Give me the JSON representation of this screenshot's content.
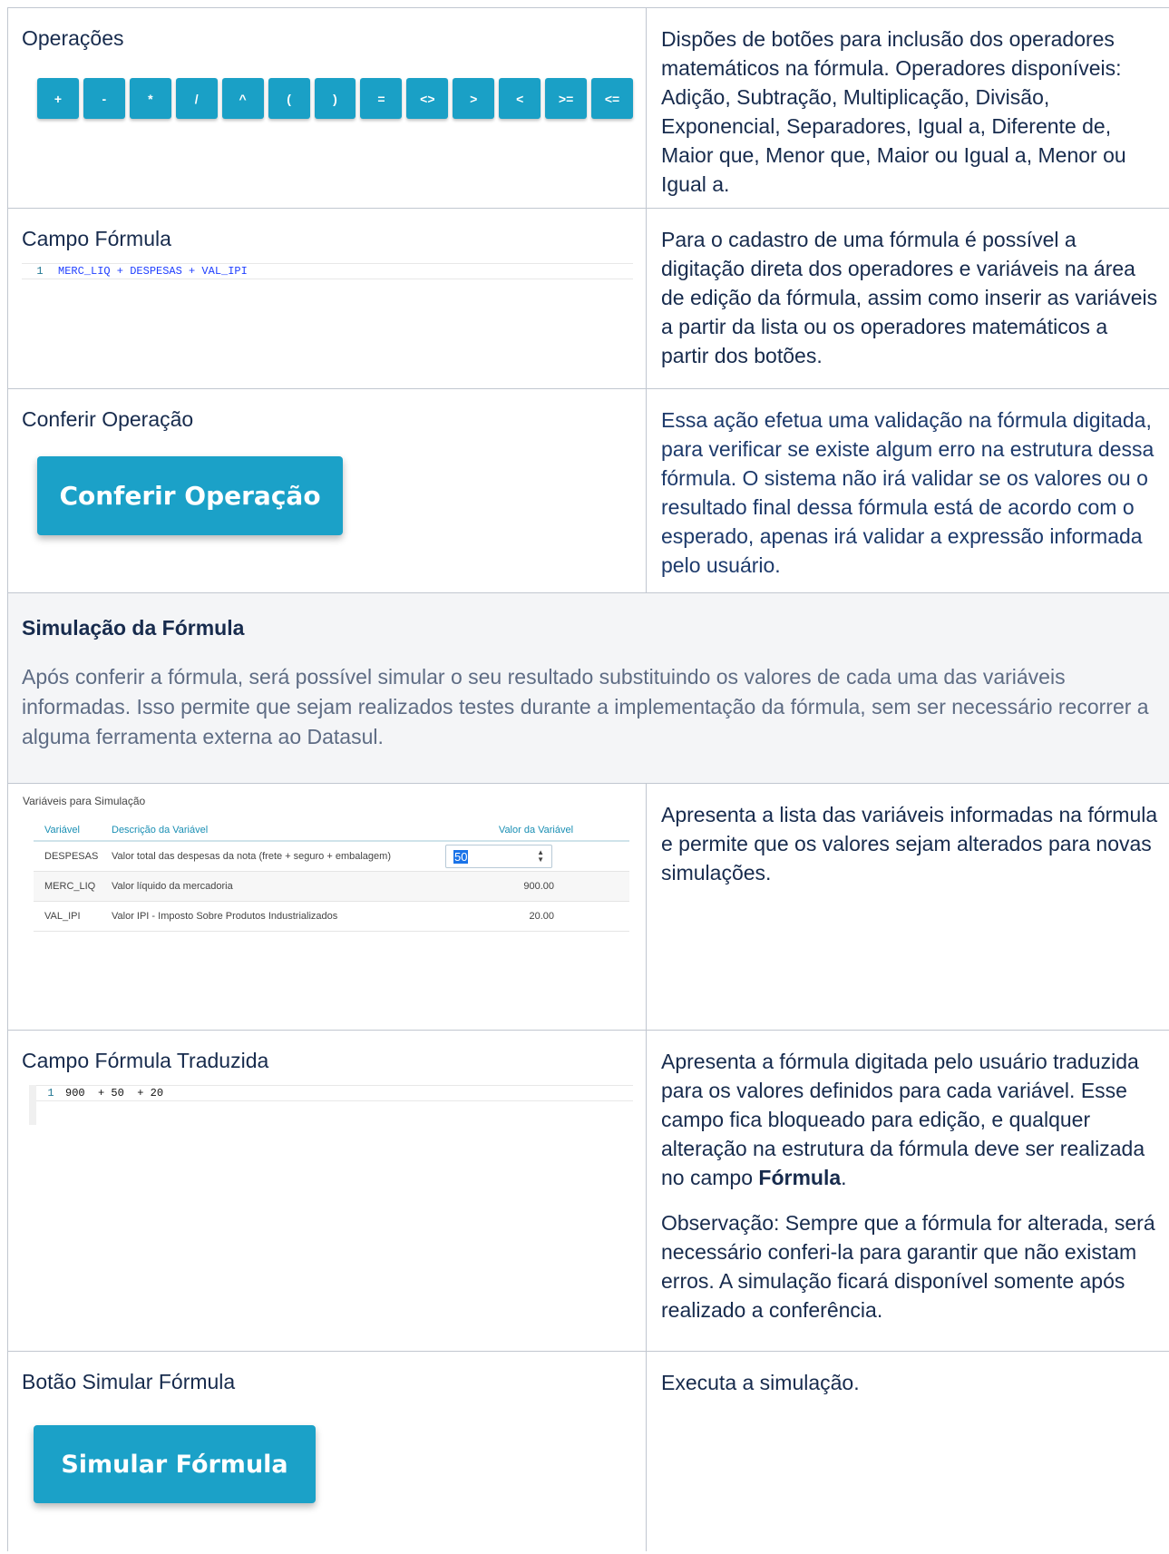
{
  "rows": {
    "operacoes": {
      "label": "Operações",
      "buttons": [
        "+",
        "-",
        "*",
        "/",
        "^",
        "(",
        ")",
        "=",
        "<>",
        ">",
        "<",
        ">=",
        "<="
      ],
      "desc": "Dispões de botões para inclusão dos operadores matemáticos na fórmula. Operadores disponíveis: Adição, Subtração, Multiplicação, Divisão, Exponencial, Separadores, Igual a, Diferente de, Maior que, Menor que, Maior ou Igual a, Menor ou Igual a."
    },
    "campo_formula": {
      "label": "Campo Fórmula",
      "line_no": "1",
      "code": "MERC_LIQ + DESPESAS + VAL_IPI",
      "desc": "Para o cadastro de uma fórmula é possível a digitação direta dos operadores e variáveis na área de edição da fórmula, assim como inserir as variáveis a partir da lista ou os operadores matemáticos a partir dos botões."
    },
    "conferir": {
      "label": "Conferir Operação",
      "button": "Conferir Operação",
      "desc": "Essa ação efetua uma validação na fórmula digitada, para verificar se existe algum erro na estrutura dessa fórmula. O sistema não irá validar se os valores ou o resultado final dessa fórmula está de acordo com o esperado, apenas irá validar a expressão informada pelo usuário."
    },
    "simulacao": {
      "heading": "Simulação da Fórmula",
      "text": "Após conferir a fórmula, será possível simular o seu resultado substituindo os valores de cada uma das variáveis informadas. Isso permite que sejam realizados testes durante a implementação da fórmula, sem ser necessário recorrer a alguma ferramenta externa ao Datasul."
    },
    "variaveis": {
      "title": "Variáveis para Simulação",
      "headers": [
        "Variável",
        "Descrição da Variável",
        "Valor da Variável"
      ],
      "items": [
        {
          "name": "DESPESAS",
          "desc": "Valor total das despesas da nota (frete + seguro + embalagem)",
          "value": "50"
        },
        {
          "name": "MERC_LIQ",
          "desc": "Valor líquido da mercadoria",
          "value": "900.00"
        },
        {
          "name": "VAL_IPI",
          "desc": "Valor IPI - Imposto Sobre Produtos Industrializados",
          "value": "20.00"
        }
      ],
      "desc": "Apresenta a lista das variáveis informadas na fórmula e permite que os valores sejam alterados para novas simulações."
    },
    "traduzida": {
      "label": "Campo Fórmula Traduzida",
      "line_no": "1",
      "code": "900  + 50  + 20",
      "desc_pre": "Apresenta a fórmula digitada pelo usuário traduzida para os valores definidos para cada variável. Esse campo fica bloqueado para edição, e qualquer alteração na estrutura da fórmula deve ser realizada no campo ",
      "desc_bold": "Fórmula",
      "desc_post": ".",
      "obs": "Observação: Sempre que a fórmula for alterada, será necessário conferi-la para garantir que não existam erros. A simulação ficará disponível somente após realizado a conferência."
    },
    "simular": {
      "label": "Botão Simular Fórmula",
      "button": "Simular Fórmula",
      "desc": "Executa a simulação."
    }
  }
}
